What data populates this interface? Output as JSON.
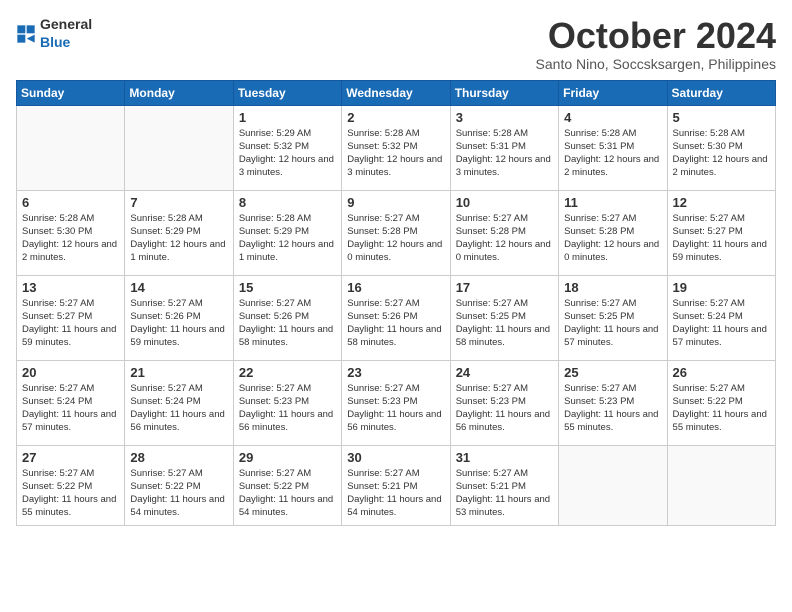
{
  "header": {
    "logo": {
      "general": "General",
      "blue": "Blue"
    },
    "title": "October 2024",
    "subtitle": "Santo Nino, Soccsksargen, Philippines"
  },
  "weekdays": [
    "Sunday",
    "Monday",
    "Tuesday",
    "Wednesday",
    "Thursday",
    "Friday",
    "Saturday"
  ],
  "weeks": [
    [
      {
        "day": "",
        "info": ""
      },
      {
        "day": "",
        "info": ""
      },
      {
        "day": "1",
        "info": "Sunrise: 5:29 AM\nSunset: 5:32 PM\nDaylight: 12 hours and 3 minutes."
      },
      {
        "day": "2",
        "info": "Sunrise: 5:28 AM\nSunset: 5:32 PM\nDaylight: 12 hours and 3 minutes."
      },
      {
        "day": "3",
        "info": "Sunrise: 5:28 AM\nSunset: 5:31 PM\nDaylight: 12 hours and 3 minutes."
      },
      {
        "day": "4",
        "info": "Sunrise: 5:28 AM\nSunset: 5:31 PM\nDaylight: 12 hours and 2 minutes."
      },
      {
        "day": "5",
        "info": "Sunrise: 5:28 AM\nSunset: 5:30 PM\nDaylight: 12 hours and 2 minutes."
      }
    ],
    [
      {
        "day": "6",
        "info": "Sunrise: 5:28 AM\nSunset: 5:30 PM\nDaylight: 12 hours and 2 minutes."
      },
      {
        "day": "7",
        "info": "Sunrise: 5:28 AM\nSunset: 5:29 PM\nDaylight: 12 hours and 1 minute."
      },
      {
        "day": "8",
        "info": "Sunrise: 5:28 AM\nSunset: 5:29 PM\nDaylight: 12 hours and 1 minute."
      },
      {
        "day": "9",
        "info": "Sunrise: 5:27 AM\nSunset: 5:28 PM\nDaylight: 12 hours and 0 minutes."
      },
      {
        "day": "10",
        "info": "Sunrise: 5:27 AM\nSunset: 5:28 PM\nDaylight: 12 hours and 0 minutes."
      },
      {
        "day": "11",
        "info": "Sunrise: 5:27 AM\nSunset: 5:28 PM\nDaylight: 12 hours and 0 minutes."
      },
      {
        "day": "12",
        "info": "Sunrise: 5:27 AM\nSunset: 5:27 PM\nDaylight: 11 hours and 59 minutes."
      }
    ],
    [
      {
        "day": "13",
        "info": "Sunrise: 5:27 AM\nSunset: 5:27 PM\nDaylight: 11 hours and 59 minutes."
      },
      {
        "day": "14",
        "info": "Sunrise: 5:27 AM\nSunset: 5:26 PM\nDaylight: 11 hours and 59 minutes."
      },
      {
        "day": "15",
        "info": "Sunrise: 5:27 AM\nSunset: 5:26 PM\nDaylight: 11 hours and 58 minutes."
      },
      {
        "day": "16",
        "info": "Sunrise: 5:27 AM\nSunset: 5:26 PM\nDaylight: 11 hours and 58 minutes."
      },
      {
        "day": "17",
        "info": "Sunrise: 5:27 AM\nSunset: 5:25 PM\nDaylight: 11 hours and 58 minutes."
      },
      {
        "day": "18",
        "info": "Sunrise: 5:27 AM\nSunset: 5:25 PM\nDaylight: 11 hours and 57 minutes."
      },
      {
        "day": "19",
        "info": "Sunrise: 5:27 AM\nSunset: 5:24 PM\nDaylight: 11 hours and 57 minutes."
      }
    ],
    [
      {
        "day": "20",
        "info": "Sunrise: 5:27 AM\nSunset: 5:24 PM\nDaylight: 11 hours and 57 minutes."
      },
      {
        "day": "21",
        "info": "Sunrise: 5:27 AM\nSunset: 5:24 PM\nDaylight: 11 hours and 56 minutes."
      },
      {
        "day": "22",
        "info": "Sunrise: 5:27 AM\nSunset: 5:23 PM\nDaylight: 11 hours and 56 minutes."
      },
      {
        "day": "23",
        "info": "Sunrise: 5:27 AM\nSunset: 5:23 PM\nDaylight: 11 hours and 56 minutes."
      },
      {
        "day": "24",
        "info": "Sunrise: 5:27 AM\nSunset: 5:23 PM\nDaylight: 11 hours and 56 minutes."
      },
      {
        "day": "25",
        "info": "Sunrise: 5:27 AM\nSunset: 5:23 PM\nDaylight: 11 hours and 55 minutes."
      },
      {
        "day": "26",
        "info": "Sunrise: 5:27 AM\nSunset: 5:22 PM\nDaylight: 11 hours and 55 minutes."
      }
    ],
    [
      {
        "day": "27",
        "info": "Sunrise: 5:27 AM\nSunset: 5:22 PM\nDaylight: 11 hours and 55 minutes."
      },
      {
        "day": "28",
        "info": "Sunrise: 5:27 AM\nSunset: 5:22 PM\nDaylight: 11 hours and 54 minutes."
      },
      {
        "day": "29",
        "info": "Sunrise: 5:27 AM\nSunset: 5:22 PM\nDaylight: 11 hours and 54 minutes."
      },
      {
        "day": "30",
        "info": "Sunrise: 5:27 AM\nSunset: 5:21 PM\nDaylight: 11 hours and 54 minutes."
      },
      {
        "day": "31",
        "info": "Sunrise: 5:27 AM\nSunset: 5:21 PM\nDaylight: 11 hours and 53 minutes."
      },
      {
        "day": "",
        "info": ""
      },
      {
        "day": "",
        "info": ""
      }
    ]
  ]
}
